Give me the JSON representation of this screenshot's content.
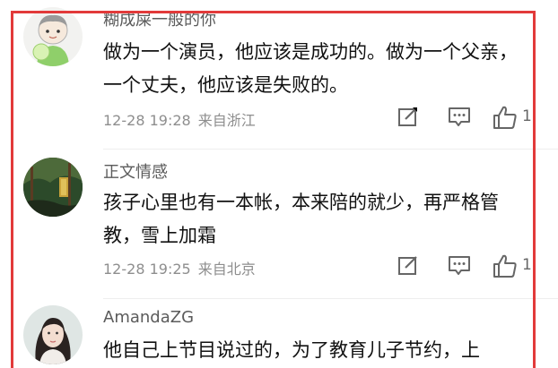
{
  "comments": [
    {
      "username": "糊成屎一般的你",
      "text": "做为一个演员，他应该是成功的。做为一个父亲，一个丈夫，他应该是失败的。",
      "time": "12-28 19:28",
      "location": "来自浙江",
      "likes": "1",
      "avatar_icon": "cartoon-kid-avatar"
    },
    {
      "username": "正文情感",
      "text": "孩子心里也有一本帐，本来陪的就少，再严格管教，雪上加霜",
      "time": "12-28 19:25",
      "location": "来自北京",
      "likes": "1",
      "avatar_icon": "forest-photo-avatar"
    },
    {
      "username": "AmandaZG",
      "text": "他自己上节目说过的，为了教育儿子节约，上",
      "avatar_icon": "woman-photo-avatar"
    }
  ],
  "colors": {
    "highlight": "#e23a3a",
    "username": "#5b5b5b",
    "meta": "#8e8e8e",
    "text": "#111111"
  },
  "icons": {
    "edit": "edit-square-icon",
    "reply": "comment-bubble-icon",
    "like": "thumbs-up-icon"
  }
}
